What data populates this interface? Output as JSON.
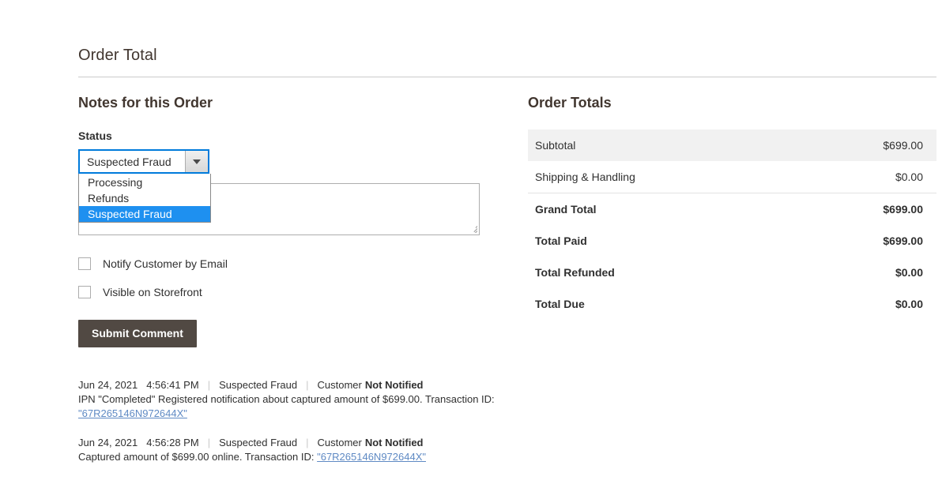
{
  "page": {
    "title": "Order Total"
  },
  "notes": {
    "section_title": "Notes for this Order",
    "status_label": "Status",
    "status_value": "Suspected Fraud",
    "status_options": [
      {
        "label": "Processing",
        "selected": false
      },
      {
        "label": "Refunds",
        "selected": false
      },
      {
        "label": "Suspected Fraud",
        "selected": true
      }
    ],
    "comment_value": "",
    "comment_placeholder": "",
    "notify_label": "Notify Customer by Email",
    "notify_checked": false,
    "visible_label": "Visible on Storefront",
    "visible_checked": false,
    "submit_label": "Submit Comment"
  },
  "history": [
    {
      "date": "Jun 24, 2021",
      "time": "4:56:41 PM",
      "status": "Suspected Fraud",
      "customer_label": "Customer",
      "notified": "Not Notified",
      "text_before": "IPN \"Completed\" Registered notification about captured amount of $699.00. Transaction ID: ",
      "transaction_id": "\"67R265146N972644X\"",
      "text_after": ""
    },
    {
      "date": "Jun 24, 2021",
      "time": "4:56:28 PM",
      "status": "Suspected Fraud",
      "customer_label": "Customer",
      "notified": "Not Notified",
      "text_before": "Captured amount of $699.00 online. Transaction ID: ",
      "transaction_id": "\"67R265146N972644X\"",
      "text_after": ""
    }
  ],
  "order_totals": {
    "section_title": "Order Totals",
    "rows": [
      {
        "label": "Subtotal",
        "value": "$699.00",
        "bold": false,
        "shaded": true,
        "bordered": false
      },
      {
        "label": "Shipping & Handling",
        "value": "$0.00",
        "bold": false,
        "shaded": false,
        "bordered": false
      },
      {
        "label": "Grand Total",
        "value": "$699.00",
        "bold": true,
        "shaded": false,
        "bordered": true
      },
      {
        "label": "Total Paid",
        "value": "$699.00",
        "bold": true,
        "shaded": false,
        "bordered": false
      },
      {
        "label": "Total Refunded",
        "value": "$0.00",
        "bold": true,
        "shaded": false,
        "bordered": false
      },
      {
        "label": "Total Due",
        "value": "$0.00",
        "bold": true,
        "shaded": false,
        "bordered": false
      }
    ]
  },
  "colors": {
    "accent_blue": "#007bdb",
    "highlight_blue": "#1e90f0",
    "link_blue": "#5f8ac4",
    "button_dark": "#514943",
    "row_shade": "#f1f1f1"
  }
}
